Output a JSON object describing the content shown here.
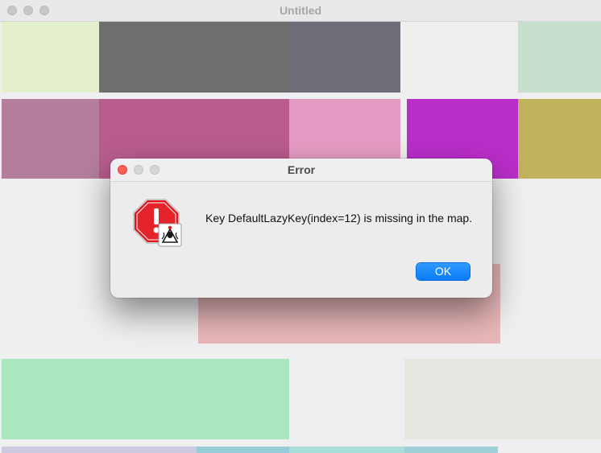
{
  "window": {
    "title": "Untitled"
  },
  "tiles": [
    {
      "name": "tile-r1-c1",
      "color": "#e4f0cb"
    },
    {
      "name": "tile-r1-c2",
      "color": "#6f6e6e"
    },
    {
      "name": "tile-r1-c3",
      "color": "#6f6e78"
    },
    {
      "name": "tile-r1-c4",
      "color": "#eeeeec"
    },
    {
      "name": "tile-r1-c5",
      "color": "#c7dfcd"
    },
    {
      "name": "tile-r2-c1",
      "color": "#b47e9c"
    },
    {
      "name": "tile-r2-c2",
      "color": "#b85c8e"
    },
    {
      "name": "tile-r2-c3",
      "color": "#e49bc3"
    },
    {
      "name": "tile-r2-c4",
      "color": "#b92ec9"
    },
    {
      "name": "tile-r2-c5",
      "color": "#bfb25b"
    },
    {
      "name": "tile-pink-block",
      "color": "#e8b7b9"
    },
    {
      "name": "tile-green-block",
      "color": "#aae6be"
    },
    {
      "name": "tile-grey-block",
      "color": "#e6e6e1"
    },
    {
      "name": "tile-bottom-strip-1",
      "color": "#cdc9e0"
    },
    {
      "name": "tile-bottom-strip-2",
      "color": "#98ccd8"
    },
    {
      "name": "tile-bottom-strip-3",
      "color": "#a9ded8"
    },
    {
      "name": "tile-bottom-strip-4",
      "color": "#9fd0d8"
    }
  ],
  "dialog": {
    "title": "Error",
    "message": "Key DefaultLazyKey(index=12) is missing in the map.",
    "ok_label": "OK",
    "icon": "error-stop-sign-with-java-badge",
    "accent_color": "#0a7bf5",
    "close_dot_color": "#fe5f57"
  }
}
